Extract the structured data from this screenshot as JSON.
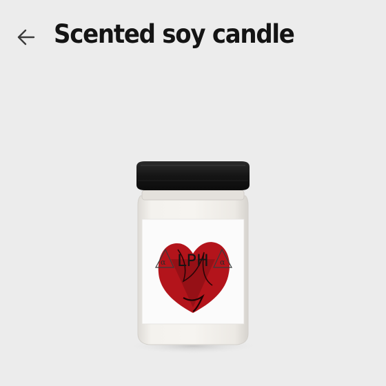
{
  "header": {
    "title": "Scented soy candle",
    "back_icon": "arrow-left-icon"
  },
  "product": {
    "label_text": "LPH",
    "label_letter": "α",
    "colors": {
      "background": "#ececec",
      "lid": "#1a1a1a",
      "wax": "#f1eeea",
      "label": "#fbfbfb",
      "artwork_red": "#b3141b"
    }
  }
}
